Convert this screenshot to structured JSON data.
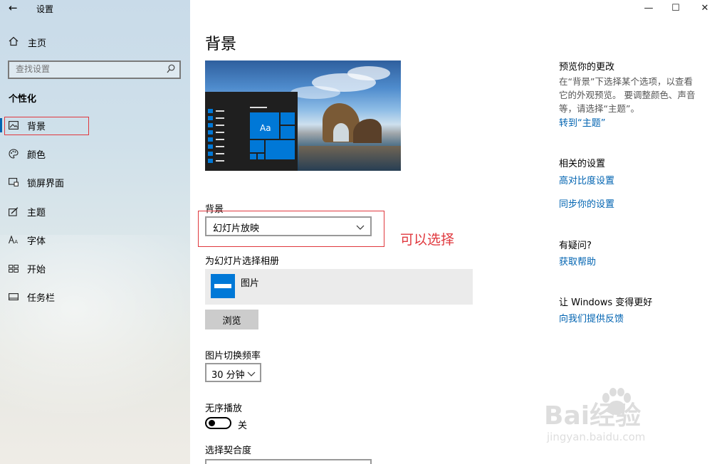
{
  "window": {
    "title": "设置",
    "minimize": "—",
    "maximize": "☐",
    "close": "✕"
  },
  "sidebar": {
    "home_label": "主页",
    "search_placeholder": "查找设置",
    "section_title": "个性化",
    "items": [
      {
        "label": "背景",
        "icon": "picture-icon",
        "active": true
      },
      {
        "label": "颜色",
        "icon": "palette-icon"
      },
      {
        "label": "锁屏界面",
        "icon": "lock-screen-icon"
      },
      {
        "label": "主题",
        "icon": "theme-brush-icon"
      },
      {
        "label": "字体",
        "icon": "font-icon"
      },
      {
        "label": "开始",
        "icon": "start-grid-icon"
      },
      {
        "label": "任务栏",
        "icon": "taskbar-icon"
      }
    ]
  },
  "main": {
    "title": "背景",
    "preview_tile_text": "Aa",
    "background_label": "背景",
    "background_value": "幻灯片放映",
    "annotation": "可以选择",
    "album_label": "为幻灯片选择相册",
    "album_name": "图片",
    "browse_label": "浏览",
    "interval_label": "图片切换频率",
    "interval_value": "30 分钟",
    "shuffle_label": "无序播放",
    "shuffle_state": "关",
    "fit_label": "选择契合度"
  },
  "right": {
    "preview_heading": "预览你的更改",
    "preview_text": "在“背景”下选择某个选项，以查看它的外观预览。 要调整颜色、声音等，请选择“主题”。",
    "preview_link": "转到“主题”",
    "related_heading": "相关的设置",
    "related_links": [
      "高对比度设置",
      "同步你的设置"
    ],
    "question_heading": "有疑问?",
    "help_link": "获取帮助",
    "improve_heading": "让 Windows 变得更好",
    "feedback_link": "向我们提供反馈"
  },
  "watermark": {
    "brand": "Bai经验",
    "url": "jingyan.baidu.com"
  },
  "colors": {
    "accent": "#0063b1",
    "annotation_red": "#e0383e",
    "tile_blue": "#0078d7"
  }
}
